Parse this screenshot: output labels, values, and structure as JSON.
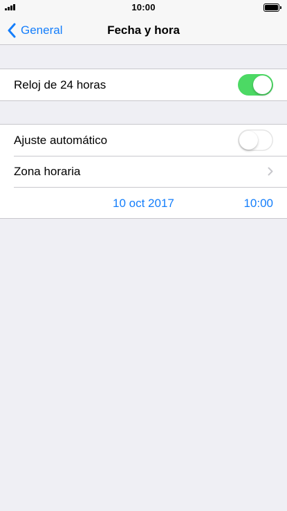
{
  "status_bar": {
    "time": "10:00",
    "signal_icon": "cellular-signal-icon",
    "battery_icon": "battery-icon",
    "battery_level": 1.0
  },
  "nav": {
    "back_label": "General",
    "back_icon": "chevron-left-icon",
    "title": "Fecha y hora"
  },
  "settings": {
    "clock_24h": {
      "label": "Reloj de 24 horas",
      "on": true
    },
    "auto_set": {
      "label": "Ajuste automático",
      "on": false
    },
    "time_zone": {
      "label": "Zona horaria",
      "icon": "chevron-right-icon"
    },
    "date": "10 oct 2017",
    "time": "10:00"
  },
  "colors": {
    "accent": "#147efb",
    "toggle_on": "#4cd964",
    "background": "#efeff4",
    "separator": "#c8c7cc"
  }
}
